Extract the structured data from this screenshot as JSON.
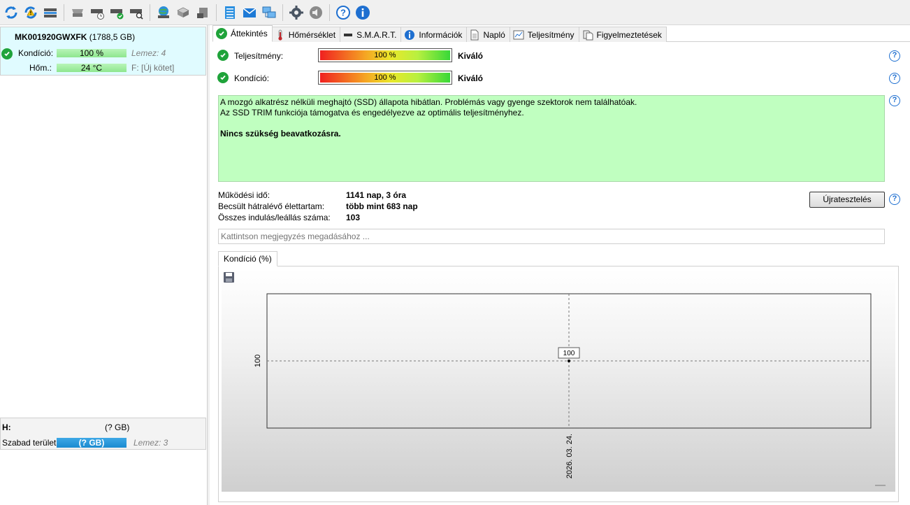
{
  "toolbar": {
    "icons": [
      "refresh-icon",
      "refresh-warning-icon",
      "drive-icon",
      "drive-grey-icon",
      "drive-clock-icon",
      "drive-check-icon",
      "drive-search-icon",
      "globe-drive-icon",
      "drive-stack-icon",
      "drive-settings-icon",
      "notepad-icon",
      "mail-icon",
      "network-icon",
      "gear-icon",
      "speaker-icon",
      "help-icon",
      "info-icon"
    ]
  },
  "left": {
    "disk": {
      "model": "MK001920GWXFK",
      "size": "(1788,5 GB)",
      "condition_label": "Kondíció:",
      "condition_value": "100 %",
      "disk_no": "Lemez: 4",
      "temp_label": "Hőm.:",
      "temp_value": "24 °C",
      "volume": "F: [Új kötet]"
    },
    "volume": {
      "letter": "H:",
      "size": "(? GB)",
      "free_label": "Szabad terület",
      "free_value": "(? GB)",
      "disk_no": "Lemez: 3"
    }
  },
  "tabs": [
    {
      "label": "Áttekintés",
      "icon": "check-icon",
      "active": true
    },
    {
      "label": "Hőmérséklet",
      "icon": "thermometer-icon"
    },
    {
      "label": "S.M.A.R.T.",
      "icon": "drive-icon"
    },
    {
      "label": "Információk",
      "icon": "info-icon"
    },
    {
      "label": "Napló",
      "icon": "document-icon"
    },
    {
      "label": "Teljesítmény",
      "icon": "performance-chart-icon"
    },
    {
      "label": "Figyelmeztetések",
      "icon": "alerts-icon"
    }
  ],
  "overview": {
    "performance_label": "Teljesítmény:",
    "performance_value": "100 %",
    "performance_rating": "Kiváló",
    "condition_label": "Kondíció:",
    "condition_value": "100 %",
    "condition_rating": "Kiváló",
    "message_line1": "A mozgó alkatrész nélküli meghajtó (SSD) állapota hibátlan. Problémás vagy gyenge szektorok nem találhatóak.",
    "message_line2": "Az SSD TRIM funkciója támogatva és engedélyezve az optimális teljesítményhez.",
    "message_line3": "Nincs szükség beavatkozásra.",
    "uptime_label": "Működési idő:",
    "uptime_value": "1141 nap, 3 óra",
    "lifetime_label": "Becsült hátralévő élettartam:",
    "lifetime_value": "több mint 683 nap",
    "starts_label": "Összes indulás/leállás száma:",
    "starts_value": "103",
    "retest_button": "Újratesztelés",
    "note_placeholder": "Kattintson megjegyzés megadásához ..."
  },
  "chart_tab": "Kondíció  (%)",
  "chart_data": {
    "type": "line",
    "x": [
      "2026. 03. 24."
    ],
    "series": [
      {
        "values": [
          100
        ]
      }
    ],
    "y_tick_labels": [
      "100"
    ],
    "data_labels": [
      "100"
    ],
    "grid": true
  }
}
